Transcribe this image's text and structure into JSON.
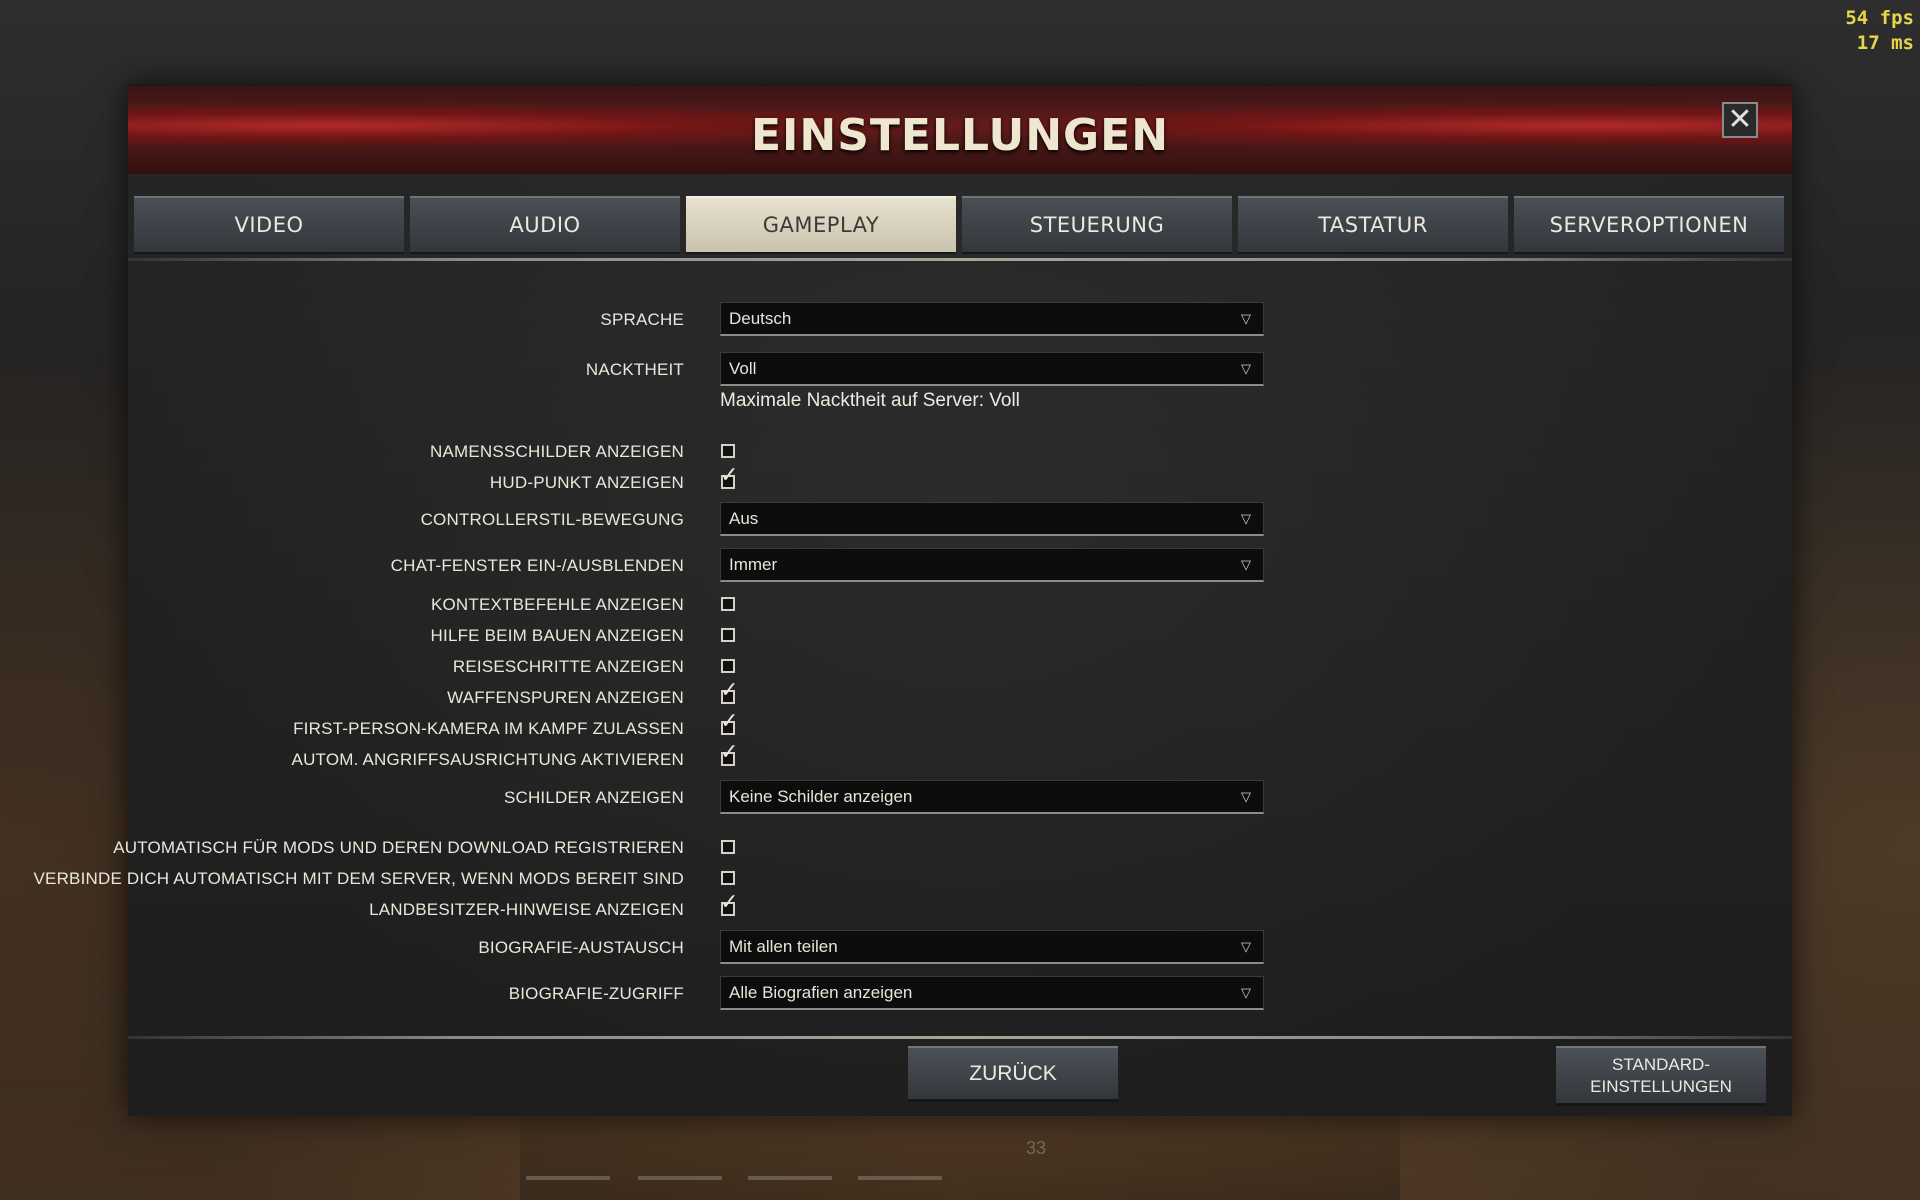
{
  "overlay": {
    "fps": "54 fps",
    "ms": "17 ms"
  },
  "dialog": {
    "title": "EINSTELLUNGEN",
    "close_label": "✕"
  },
  "tabs": [
    {
      "label": "VIDEO",
      "active": false
    },
    {
      "label": "AUDIO",
      "active": false
    },
    {
      "label": "GAMEPLAY",
      "active": true
    },
    {
      "label": "STEUERUNG",
      "active": false
    },
    {
      "label": "TASTATUR",
      "active": false
    },
    {
      "label": "SERVEROPTIONEN",
      "active": false
    }
  ],
  "settings": {
    "sprache": {
      "label": "SPRACHE",
      "value": "Deutsch"
    },
    "nacktheit": {
      "label": "NACKTHEIT",
      "value": "Voll",
      "note": "Maximale Nacktheit auf Server: Voll"
    },
    "namensschilder": {
      "label": "NAMENSSCHILDER ANZEIGEN",
      "checked": false
    },
    "hud_punkt": {
      "label": "HUD-PUNKT ANZEIGEN",
      "checked": true
    },
    "controllerstil": {
      "label": "CONTROLLERSTIL-BEWEGUNG",
      "value": "Aus"
    },
    "chat_fenster": {
      "label": "CHAT-FENSTER EIN-/AUSBLENDEN",
      "value": "Immer"
    },
    "kontextbefehle": {
      "label": "KONTEXTBEFEHLE ANZEIGEN",
      "checked": false
    },
    "hilfe_bauen": {
      "label": "HILFE BEIM BAUEN ANZEIGEN",
      "checked": false
    },
    "reiseschritte": {
      "label": "REISESCHRITTE ANZEIGEN",
      "checked": false
    },
    "waffenspuren": {
      "label": "WAFFENSPUREN ANZEIGEN",
      "checked": true
    },
    "first_person": {
      "label": "FIRST-PERSON-KAMERA IM KAMPF ZULASSEN",
      "checked": true
    },
    "angriffsausrichtung": {
      "label": "AUTOM. ANGRIFFSAUSRICHTUNG AKTIVIEREN",
      "checked": true
    },
    "schilder": {
      "label": "SCHILDER ANZEIGEN",
      "value": "Keine Schilder anzeigen"
    },
    "mods_registrieren": {
      "label": "AUTOMATISCH FÜR MODS UND DEREN DOWNLOAD REGISTRIEREN",
      "checked": false
    },
    "mods_verbinden": {
      "label": "VERBINDE DICH AUTOMATISCH MIT DEM SERVER, WENN MODS BEREIT SIND",
      "checked": false
    },
    "landbesitzer": {
      "label": "LANDBESITZER-HINWEISE ANZEIGEN",
      "checked": true
    },
    "biografie_austausch": {
      "label": "BIOGRAFIE-AUSTAUSCH",
      "value": "Mit allen teilen"
    },
    "biografie_zugriff": {
      "label": "BIOGRAFIE-ZUGRIFF",
      "value": "Alle Biografien anzeigen"
    }
  },
  "select_arrow": "▽",
  "check_glyph": "✓",
  "buttons": {
    "back": "ZURÜCK",
    "default_line1": "STANDARD-",
    "default_line2": "EINSTELLUNGEN"
  },
  "hud": {
    "number": "33"
  }
}
